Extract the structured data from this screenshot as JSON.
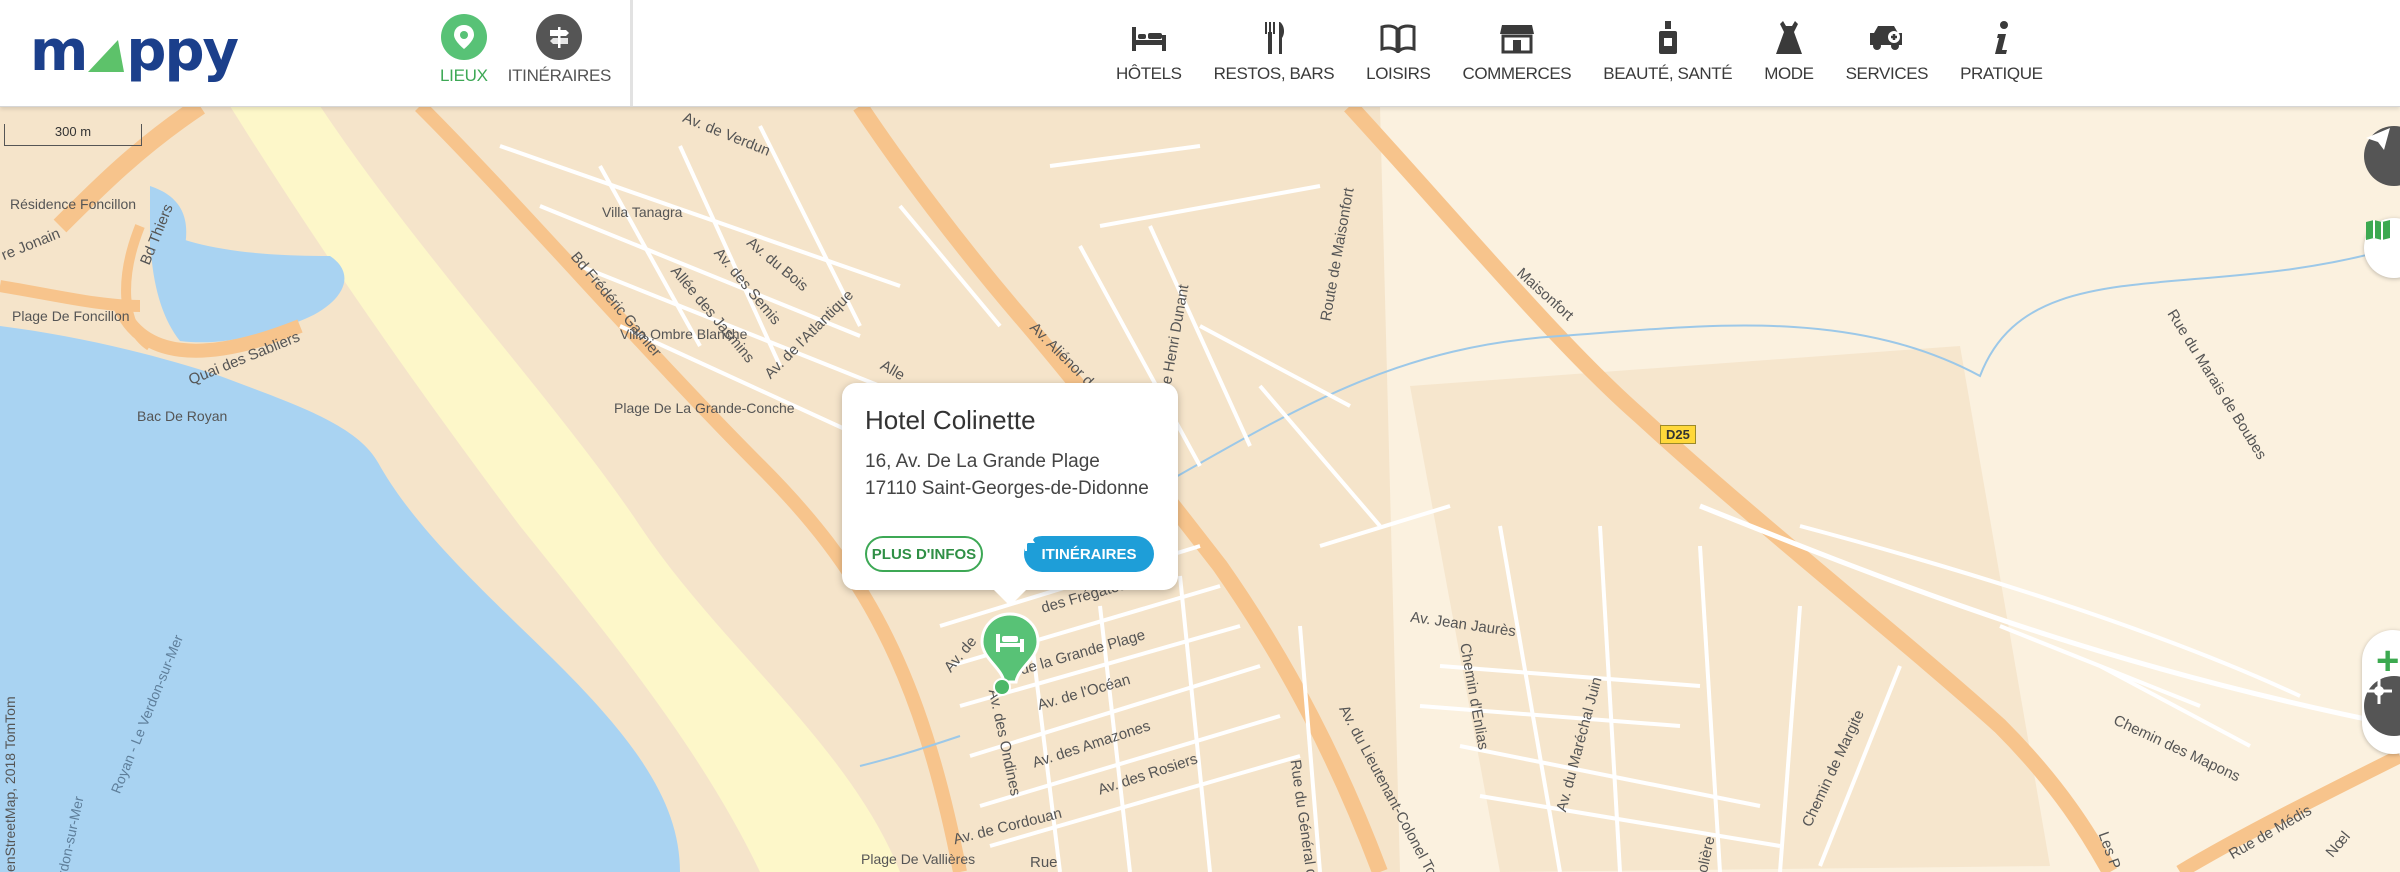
{
  "logo": {
    "part1": "m",
    "part2": "ppy"
  },
  "modes": [
    {
      "label": "LIEUX",
      "icon": "place-pin-icon",
      "active": true,
      "color": "#58c276"
    },
    {
      "label": "ITINÉRAIRES",
      "icon": "signpost-icon",
      "active": false,
      "color": "#555555"
    }
  ],
  "categories": [
    {
      "label": "HÔTELS",
      "icon": "bed-icon"
    },
    {
      "label": "RESTOS, BARS",
      "icon": "fork-knife-icon"
    },
    {
      "label": "LOISIRS",
      "icon": "book-icon"
    },
    {
      "label": "COMMERCES",
      "icon": "shop-icon"
    },
    {
      "label": "BEAUTÉ, SANTÉ",
      "icon": "perfume-bottle-icon"
    },
    {
      "label": "MODE",
      "icon": "dress-icon"
    },
    {
      "label": "SERVICES",
      "icon": "car-service-icon"
    },
    {
      "label": "PRATIQUE",
      "icon": "info-icon"
    }
  ],
  "popup": {
    "title": "Hotel Colinette",
    "address_line1": "16, Av. De La Grande Plage",
    "address_line2": "17110 Saint-Georges-de-Didonne",
    "more_info": "PLUS D'INFOS",
    "itineraries": "ITINÉRAIRES"
  },
  "map": {
    "scale": "300 m",
    "copyright": "enStreetMap, 2018 TomTom",
    "road_badge": "D25",
    "pois": [
      "Résidence Foncillon",
      "Plage De Foncillon",
      "Bac De Royan",
      "Villa Tanagra",
      "Villa Ombre Blanche",
      "Plage De La Grande-Conche",
      "Plage De Vallières"
    ],
    "streets": [
      "Av. de Verdun",
      "re Jonain",
      "Bd Thiers",
      "Quai des Sabliers",
      "Bd Frédéric Garnier",
      "Av. du Bois",
      "Av. des Semis",
      "Allée des Jasmins",
      "Av. de l'Atlantique",
      "Av. Aliénor d",
      "Alle",
      "ue Henri Dunant",
      "Route de Maisonfort",
      "Maisonfort",
      "Rue du Marais de Boubes",
      "des Frégates",
      "de la Grande Plage",
      "Av. de l'Océan",
      "Av. des Amazones",
      "Av. des Rosiers",
      "Av. de Cordouan",
      "Av. des Ondines",
      "Av. de",
      "Rue du Général de Ga",
      "Av. du Lieutenant-Colonel Tou",
      "Av. Jean Jaurès",
      "Chemin d'Enlias",
      "Av. du Maréchal Juin",
      "Chemin de Margite",
      "Chemin des Mapons",
      "Rue de Médis",
      "Royan - Le Verdon-sur-Mer",
      "Verdon-sur-Mer",
      "Rue",
      "Les P",
      "Nœl",
      "olière"
    ]
  },
  "colors": {
    "brand_blue": "#1b3f8b",
    "brand_green": "#5dc26a",
    "water": "#a9d3f2",
    "land": "#fbf1df",
    "road": "#f7c48c"
  }
}
